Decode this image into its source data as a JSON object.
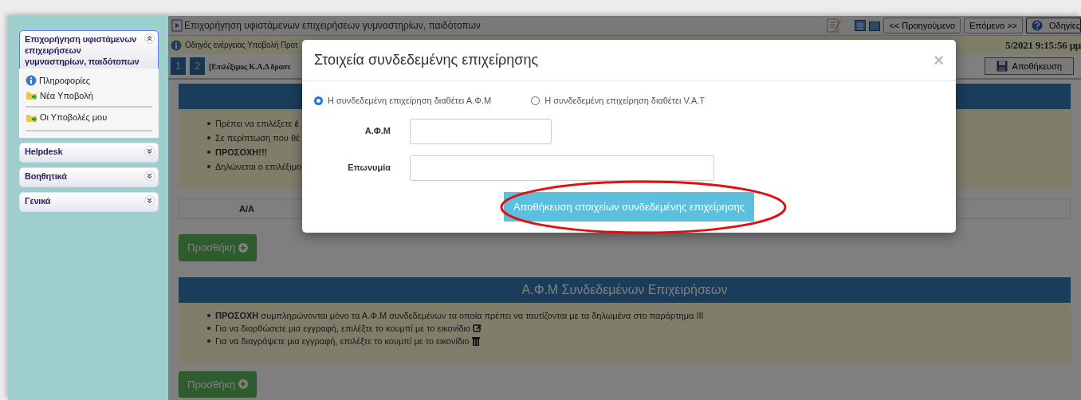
{
  "sidebar": {
    "sections": [
      {
        "title": "Επιχορήγηση υφιστάμενων επιχειρήσεων γυμναστηρίων, παιδότοπων",
        "expanded": true,
        "items": [
          {
            "label": "Πληροφορίες",
            "kind": "info"
          },
          {
            "label": "Νέα Υποβολή",
            "kind": "folder"
          },
          {
            "label": "Οι Υποβολές μου",
            "kind": "folder"
          }
        ]
      },
      {
        "title": "Helpdesk",
        "expanded": false
      },
      {
        "title": "Βοηθητικά",
        "expanded": false
      },
      {
        "title": "Γενικά",
        "expanded": false
      }
    ]
  },
  "toolbar": {
    "title": "Επιχορήγηση υφιστάμενων επιχειρήσεων γυμναστηρίων, παιδότοπων",
    "prev": "<< Προηγούμενο",
    "next": "Επόμενο >>",
    "help": "Οδηγίες"
  },
  "guide": {
    "text": "Οδηγός ενέργειας Υποβολή Προτ",
    "timestamp": "5/2021 9:15:56 μμ"
  },
  "steps": [
    {
      "label": "1"
    },
    {
      "label": "2"
    }
  ],
  "step_title": "[Επιλέξιμος Κ.Α.Δ δραστ",
  "save_button": "Αποθήκευση",
  "panel_1": {
    "notes": [
      {
        "text": "Πρέπει να επιλέξετε **έ**",
        "bold": false
      },
      {
        "text": "Σε περίπτωση που θέ",
        "bold": false
      },
      {
        "text": "ΠΡΟΣΟΧΗ!!!",
        "bold": true
      },
      {
        "text": "Δηλώνεται ο επιλέξιμο",
        "bold": false
      }
    ],
    "columns": [
      "Α/Α"
    ],
    "add_button": "Προσθήκη"
  },
  "panel_2": {
    "title": "Α.Φ.Μ Συνδεδεμένων Επιχειρήσεων",
    "notes": [
      {
        "text": "**ΠΡΟΣΟΧΗ** συμπληρώνονται μόνο τα Α.Φ.Μ συνδεδεμένων τα οποία πρέπει να ταυτίζονται με τα δηλωμένα στο παράρτημα III",
        "kind": "plain"
      },
      {
        "text": "Για να διορθώσετε μια εγγραφή, επιλέξτε το κουμπί με το εικονίδιο",
        "kind": "edit"
      },
      {
        "text": "Για να διαγράψετε μια εγγραφή, επιλέξτε το κουμπί με το εικονίδιο",
        "kind": "trash"
      }
    ],
    "add_button": "Προσθήκη"
  },
  "modal": {
    "title": "Στοιχεία συνδεδεμένης επιχείρησης",
    "close": "×",
    "options": [
      {
        "label": "Η συνδεδεμένη επιχείρηση διαθέτει Α.Φ.Μ",
        "selected": true
      },
      {
        "label": "Η συνδεδεμένη επιχείρηση διαθέτει V.A.T",
        "selected": false
      }
    ],
    "fields": [
      {
        "label": "Α.Φ.Μ",
        "kind": "short"
      },
      {
        "label": "Επωνυμία",
        "kind": "long"
      }
    ],
    "save_button": "Αποθήκευση στοιχείων συνδεδεμένης επιχείρησης",
    "circled": true
  }
}
